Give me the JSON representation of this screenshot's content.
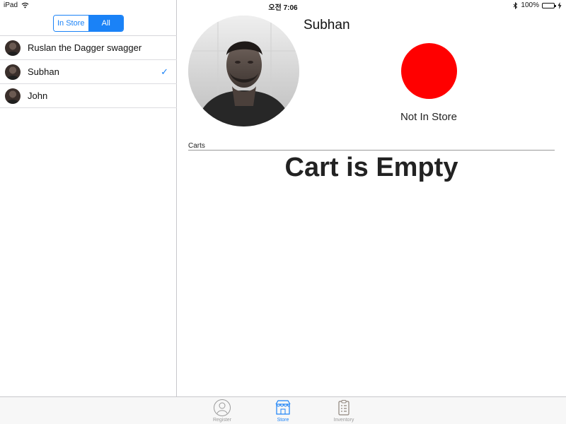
{
  "status_bar": {
    "device": "iPad",
    "time": "오전 7:06",
    "battery": "100%"
  },
  "master": {
    "segments": [
      {
        "label": "In Store",
        "active": false
      },
      {
        "label": "All",
        "active": true
      }
    ],
    "people": [
      {
        "name": "Ruslan the Dagger swagger",
        "selected": false
      },
      {
        "name": "Subhan",
        "selected": true
      },
      {
        "name": "John",
        "selected": false
      }
    ],
    "checkmark": "✓"
  },
  "detail": {
    "name": "Subhan",
    "status": "Not In Store",
    "status_color": "#ff0000",
    "carts_label": "Carts",
    "cart_empty": "Cart is Empty"
  },
  "tabs": [
    {
      "label": "Register",
      "icon": "person-icon",
      "active": false
    },
    {
      "label": "Store",
      "icon": "store-icon",
      "active": true
    },
    {
      "label": "Inventory",
      "icon": "clipboard-icon",
      "active": false
    }
  ],
  "colors": {
    "accent": "#1a82f7",
    "inactive_tab": "#9a9a9a"
  }
}
